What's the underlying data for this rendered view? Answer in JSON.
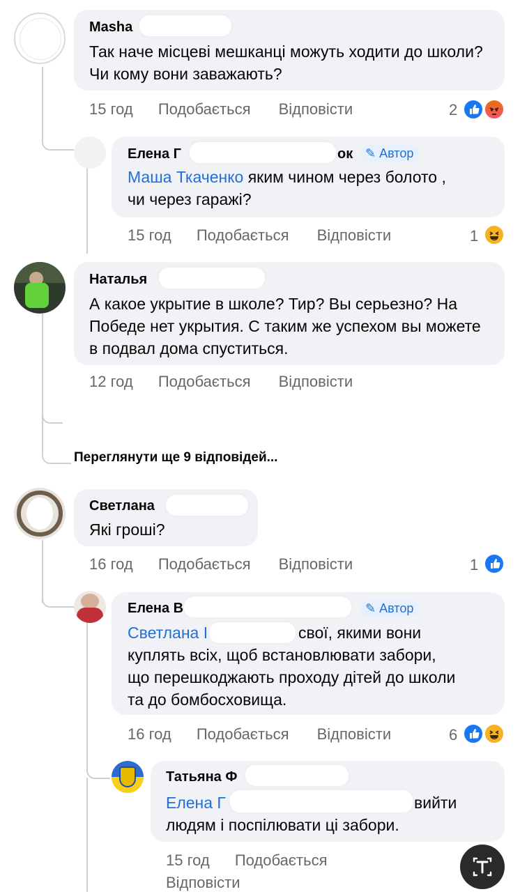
{
  "comments": [
    {
      "name": "Masha",
      "text": "Так наче місцеві мешканці можуть ходити до школи? Чи кому вони заважають?",
      "time": "15 год",
      "like_label": "Подобається",
      "reply_label": "Відповісти",
      "reactions_count": "2",
      "reactions": [
        "like-icon",
        "angry-icon"
      ]
    },
    {
      "name": "Елена Г",
      "name_tail": "ок",
      "author_badge": "Автор",
      "mention": "Маша Ткаченко",
      "text": " яким чином через болото , чи через гаражі?",
      "time": "15 год",
      "like_label": "Подобається",
      "reply_label": "Відповісти",
      "reactions_count": "1",
      "reactions": [
        "haha-icon"
      ]
    },
    {
      "name": "Наталья",
      "text": "А какое укрытие в школе? Тир? Вы серьезно? На Победе нет укрытия. С таким же успехом вы можете в подвал дома спуститься.",
      "time": "12 год",
      "like_label": "Подобається",
      "reply_label": "Відповісти"
    },
    {
      "name": "Светлана",
      "text": "Які гроші?",
      "time": "16 год",
      "like_label": "Подобається",
      "reply_label": "Відповісти",
      "reactions_count": "1",
      "reactions": [
        "like-icon"
      ]
    },
    {
      "name": "Елена В",
      "author_badge": "Автор",
      "mention": "Светлана І",
      "text_line1": "свої, якими вони",
      "text_rest": "куплять всіх, щоб встановлювати забори, що перешкоджають проходу дітей до школи та до бомбосховища.",
      "time": "16 год",
      "like_label": "Подобається",
      "reply_label": "Відповісти",
      "reactions_count": "6",
      "reactions": [
        "like-icon",
        "haha-icon"
      ]
    },
    {
      "name": "Татьяна Ф",
      "mention": "Елена Г",
      "text_line1": "вийти",
      "text_rest": "людям і поспілювати ці забори.",
      "time": "15 год",
      "like_label": "Подобається",
      "reply_label": "Відповісти"
    }
  ],
  "more_replies": "Переглянути ще 9 відповідей...",
  "colors": {
    "bubble": "#f0f2f5",
    "meta": "#65676b",
    "mention": "#216fdb",
    "like": "#1877f2"
  }
}
